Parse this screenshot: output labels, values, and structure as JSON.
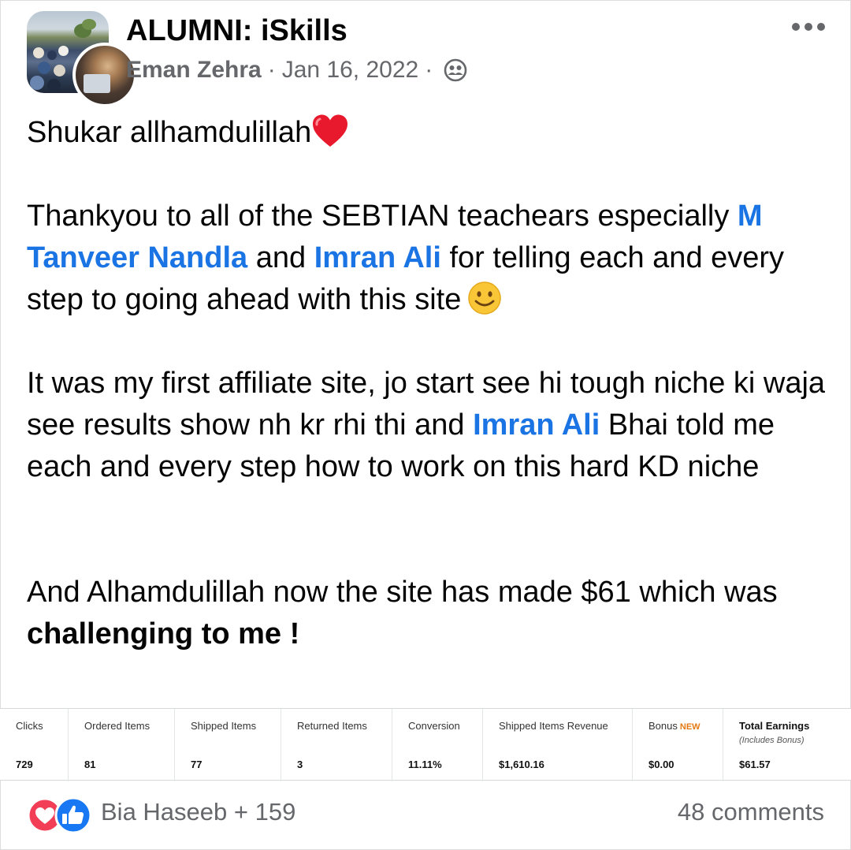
{
  "post": {
    "group_name": "ALUMNI: iSkills",
    "author": "Eman Zehra",
    "separator": "·",
    "date": "Jan 16, 2022",
    "privacy_icon": "group-privacy-icon",
    "more_icon": "more-options-icon",
    "body": {
      "line1": "Shukar allhamdulillah",
      "p2_part1": "Thankyou to all of the SEBTIAN teachears especially ",
      "mention1": "M Tanveer Nandla",
      "p2_part2": " and ",
      "mention2": "Imran Ali",
      "p2_part3": " for telling each and every step to going ahead with this site",
      "p3_part1": "It was my first affiliate site, jo start see hi tough niche ki waja see results show nh kr rhi thi and ",
      "mention3": "Imran Ali",
      "p3_part2": " Bhai told me each and every step how to work on this hard KD niche",
      "p4_part1": "And Alhamdulillah now the site has made $61 which was ",
      "p4_bold": "challenging to me !"
    }
  },
  "stats": {
    "columns": [
      {
        "header": "Clicks",
        "value": "729"
      },
      {
        "header": "Ordered Items",
        "value": "81"
      },
      {
        "header": "Shipped Items",
        "value": "77"
      },
      {
        "header": "Returned Items",
        "value": "3"
      },
      {
        "header": "Conversion",
        "value": "11.11%"
      },
      {
        "header": "Shipped Items Revenue",
        "value": "$1,610.16"
      },
      {
        "header": "Bonus",
        "badge": "NEW",
        "value": "$0.00"
      },
      {
        "header": "Total Earnings",
        "sub": "(Includes Bonus)",
        "value": "$61.57"
      }
    ]
  },
  "footer": {
    "reactors": "Bia Haseeb + 159",
    "comments": "48 comments",
    "reaction_icons": [
      "love-reaction-icon",
      "like-reaction-icon"
    ]
  },
  "colors": {
    "mention": "#1b74e4",
    "meta": "#65676b",
    "love": "#f33e58",
    "like": "#1877f2",
    "badge": "#e47911"
  }
}
